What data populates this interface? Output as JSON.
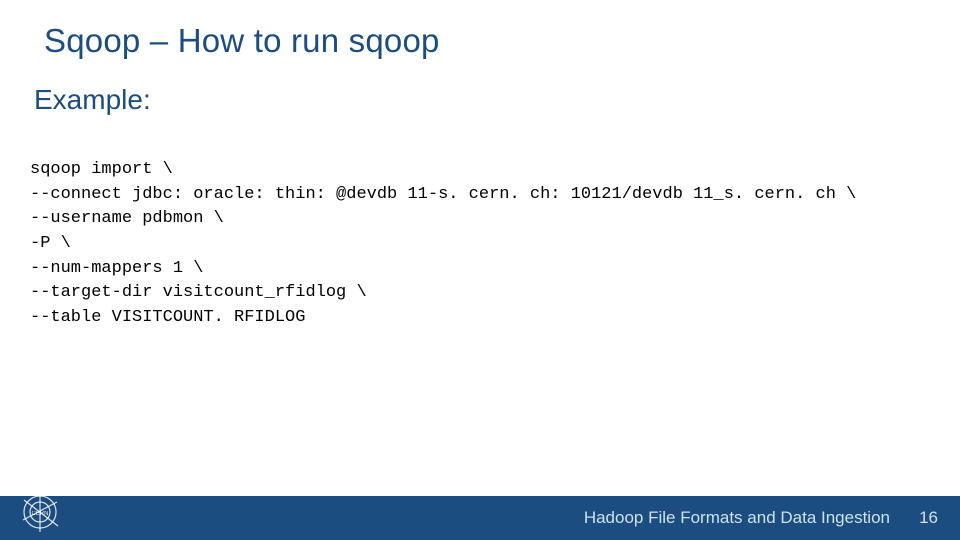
{
  "title": "Sqoop – How to run sqoop",
  "subtitle": "Example:",
  "code": {
    "l1": "sqoop import \\",
    "l2": "--connect jdbc: oracle: thin: @devdb 11-s. cern. ch: 10121/devdb 11_s. cern. ch \\",
    "l3": "--username pdbmon \\",
    "l4": "-P \\",
    "l5": "--num-mappers 1 \\",
    "l6": "--target-dir visitcount_rfidlog \\",
    "l7": "--table VISITCOUNT. RFIDLOG"
  },
  "footer": {
    "title": "Hadoop File Formats and Data Ingestion",
    "page": "16"
  },
  "logo_name": "cern-logo"
}
